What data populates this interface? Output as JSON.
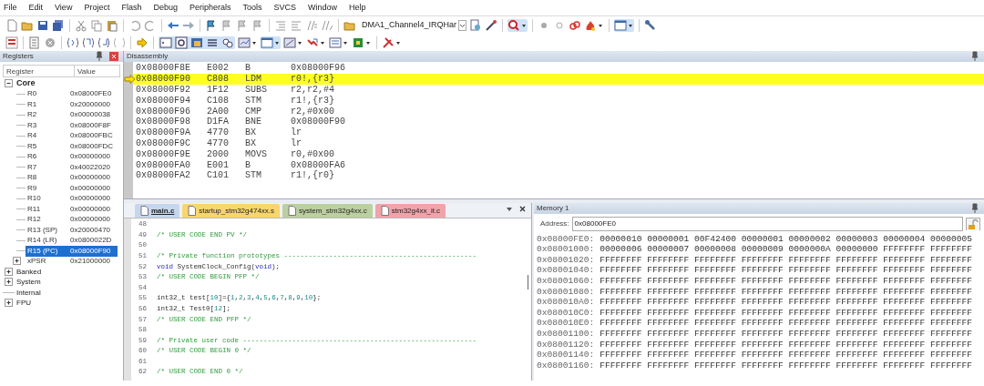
{
  "menu": [
    "File",
    "Edit",
    "View",
    "Project",
    "Flash",
    "Debug",
    "Peripherals",
    "Tools",
    "SVCS",
    "Window",
    "Help"
  ],
  "toolbar": {
    "function_combo": "DMA1_Channel4_IRQHar"
  },
  "registers": {
    "title": "Registers",
    "columns": [
      "Register",
      "Value"
    ],
    "tree": [
      {
        "name": "Core",
        "expanded": true,
        "children": [
          {
            "name": "R0",
            "value": "0x08000FE0",
            "selected": false
          },
          {
            "name": "R1",
            "value": "0x20000000",
            "selected": false
          },
          {
            "name": "R2",
            "value": "0x00000038",
            "selected": false
          },
          {
            "name": "R3",
            "value": "0x08000F8F",
            "selected": false
          },
          {
            "name": "R4",
            "value": "0x08000FBC",
            "selected": false
          },
          {
            "name": "R5",
            "value": "0x08000FDC",
            "selected": false
          },
          {
            "name": "R6",
            "value": "0x00000000",
            "selected": false
          },
          {
            "name": "R7",
            "value": "0x40022020",
            "selected": false
          },
          {
            "name": "R8",
            "value": "0x00000000",
            "selected": false
          },
          {
            "name": "R9",
            "value": "0x00000000",
            "selected": false
          },
          {
            "name": "R10",
            "value": "0x00000000",
            "selected": false
          },
          {
            "name": "R11",
            "value": "0x00000000",
            "selected": false
          },
          {
            "name": "R12",
            "value": "0x00000000",
            "selected": false
          },
          {
            "name": "R13 (SP)",
            "value": "0x20000470",
            "selected": false
          },
          {
            "name": "R14 (LR)",
            "value": "0x0800022D",
            "selected": false
          },
          {
            "name": "R15 (PC)",
            "value": "0x08000F90",
            "selected": true
          },
          {
            "name": "xPSR",
            "value": "0x21000000",
            "selected": false,
            "expanded": false
          }
        ]
      },
      {
        "name": "Banked",
        "expanded": false
      },
      {
        "name": "System",
        "expanded": false
      },
      {
        "name": "Internal"
      },
      {
        "name": "FPU",
        "expanded": false
      }
    ]
  },
  "disassembly": {
    "title": "Disassembly",
    "rows": [
      {
        "address": "0x08000F8E",
        "opcode": "E002",
        "mnemonic": "B",
        "operands": "0x08000F96",
        "current": false
      },
      {
        "address": "0x08000F90",
        "opcode": "C808",
        "mnemonic": "LDM",
        "operands": "r0!,{r3}",
        "current": true
      },
      {
        "address": "0x08000F92",
        "opcode": "1F12",
        "mnemonic": "SUBS",
        "operands": "r2,r2,#4",
        "current": false
      },
      {
        "address": "0x08000F94",
        "opcode": "C108",
        "mnemonic": "STM",
        "operands": "r1!,{r3}",
        "current": false
      },
      {
        "address": "0x08000F96",
        "opcode": "2A00",
        "mnemonic": "CMP",
        "operands": "r2,#0x00",
        "current": false
      },
      {
        "address": "0x08000F98",
        "opcode": "D1FA",
        "mnemonic": "BNE",
        "operands": "0x08000F90",
        "current": false
      },
      {
        "address": "0x08000F9A",
        "opcode": "4770",
        "mnemonic": "BX",
        "operands": "lr",
        "current": false
      },
      {
        "address": "0x08000F9C",
        "opcode": "4770",
        "mnemonic": "BX",
        "operands": "lr",
        "current": false
      },
      {
        "address": "0x08000F9E",
        "opcode": "2000",
        "mnemonic": "MOVS",
        "operands": "r0,#0x00",
        "current": false
      },
      {
        "address": "0x08000FA0",
        "opcode": "E001",
        "mnemonic": "B",
        "operands": "0x08000FA6",
        "current": false
      },
      {
        "address": "0x08000FA2",
        "opcode": "C101",
        "mnemonic": "STM",
        "operands": "r1!,{r0}",
        "current": false
      }
    ]
  },
  "editor": {
    "tabs": [
      {
        "label": "main.c",
        "selected": true,
        "color": "#c6d6ec"
      },
      {
        "label": "startup_stm32g474xx.s",
        "selected": false,
        "color": "#f8d66c"
      },
      {
        "label": "system_stm32g4xx.c",
        "selected": false,
        "color": "#bccf9f"
      },
      {
        "label": "stm32g4xx_it.c",
        "selected": false,
        "color": "#f1a3aa"
      }
    ],
    "lines": [
      {
        "number": "48"
      },
      {
        "number": "49",
        "tokens": [
          {
            "kind": "comment",
            "text": "/* USER CODE END PV */"
          }
        ]
      },
      {
        "number": "50"
      },
      {
        "number": "51",
        "tokens": [
          {
            "kind": "comment",
            "text": "/* Private function prototypes -----------------------------------------------"
          }
        ]
      },
      {
        "number": "52",
        "tokens": [
          {
            "kind": "keyword",
            "text": "void"
          },
          {
            "kind": "plain",
            "text": " SystemClock_Config("
          },
          {
            "kind": "keyword",
            "text": "void"
          },
          {
            "kind": "plain",
            "text": ");"
          }
        ]
      },
      {
        "number": "53",
        "tokens": [
          {
            "kind": "comment",
            "text": "/* USER CODE BEGIN PFP */"
          }
        ]
      },
      {
        "number": "54"
      },
      {
        "number": "55",
        "tokens": [
          {
            "kind": "plain",
            "text": "int32_t test["
          },
          {
            "kind": "number",
            "text": "10"
          },
          {
            "kind": "plain",
            "text": "]={"
          },
          {
            "kind": "number",
            "text": "1"
          },
          {
            "kind": "plain",
            "text": ","
          },
          {
            "kind": "number",
            "text": "2"
          },
          {
            "kind": "plain",
            "text": ","
          },
          {
            "kind": "number",
            "text": "3"
          },
          {
            "kind": "plain",
            "text": ","
          },
          {
            "kind": "number",
            "text": "4"
          },
          {
            "kind": "plain",
            "text": ","
          },
          {
            "kind": "number",
            "text": "5"
          },
          {
            "kind": "plain",
            "text": ","
          },
          {
            "kind": "number",
            "text": "6"
          },
          {
            "kind": "plain",
            "text": ","
          },
          {
            "kind": "number",
            "text": "7"
          },
          {
            "kind": "plain",
            "text": ","
          },
          {
            "kind": "number",
            "text": "8"
          },
          {
            "kind": "plain",
            "text": ","
          },
          {
            "kind": "number",
            "text": "9"
          },
          {
            "kind": "plain",
            "text": ","
          },
          {
            "kind": "number",
            "text": "10"
          },
          {
            "kind": "plain",
            "text": "};"
          }
        ]
      },
      {
        "number": "56",
        "tokens": [
          {
            "kind": "plain",
            "text": "int32_t Test0["
          },
          {
            "kind": "number",
            "text": "12"
          },
          {
            "kind": "plain",
            "text": "];"
          }
        ]
      },
      {
        "number": "57",
        "tokens": [
          {
            "kind": "comment",
            "text": "/* USER CODE END PFP */"
          }
        ]
      },
      {
        "number": "58"
      },
      {
        "number": "59",
        "tokens": [
          {
            "kind": "comment",
            "text": "/* Private user code ---------------------------------------------------------"
          }
        ]
      },
      {
        "number": "60",
        "tokens": [
          {
            "kind": "comment",
            "text": "/* USER CODE BEGIN 0 */"
          }
        ]
      },
      {
        "number": "61"
      },
      {
        "number": "62",
        "tokens": [
          {
            "kind": "comment",
            "text": "/* USER CODE END 0 */"
          }
        ]
      }
    ]
  },
  "memory": {
    "title": "Memory 1",
    "address_label": "Address:",
    "address": "0x08000FE0",
    "rows": [
      {
        "address": "0x08000FE0:",
        "values": "00000010 00000001 00F42400 00000001 00000002 00000003 00000004 00000005"
      },
      {
        "address": "0x08001000:",
        "values": "00000006 00000007 00000008 00000009 0000000A 00000000 FFFFFFFF FFFFFFFF"
      },
      {
        "address": "0x08001020:",
        "values": "FFFFFFFF FFFFFFFF FFFFFFFF FFFFFFFF FFFFFFFF FFFFFFFF FFFFFFFF FFFFFFFF"
      },
      {
        "address": "0x08001040:",
        "values": "FFFFFFFF FFFFFFFF FFFFFFFF FFFFFFFF FFFFFFFF FFFFFFFF FFFFFFFF FFFFFFFF"
      },
      {
        "address": "0x08001060:",
        "values": "FFFFFFFF FFFFFFFF FFFFFFFF FFFFFFFF FFFFFFFF FFFFFFFF FFFFFFFF FFFFFFFF"
      },
      {
        "address": "0x08001080:",
        "values": "FFFFFFFF FFFFFFFF FFFFFFFF FFFFFFFF FFFFFFFF FFFFFFFF FFFFFFFF FFFFFFFF"
      },
      {
        "address": "0x080010A0:",
        "values": "FFFFFFFF FFFFFFFF FFFFFFFF FFFFFFFF FFFFFFFF FFFFFFFF FFFFFFFF FFFFFFFF"
      },
      {
        "address": "0x080010C0:",
        "values": "FFFFFFFF FFFFFFFF FFFFFFFF FFFFFFFF FFFFFFFF FFFFFFFF FFFFFFFF FFFFFFFF"
      },
      {
        "address": "0x080010E0:",
        "values": "FFFFFFFF FFFFFFFF FFFFFFFF FFFFFFFF FFFFFFFF FFFFFFFF FFFFFFFF FFFFFFFF"
      },
      {
        "address": "0x08001100:",
        "values": "FFFFFFFF FFFFFFFF FFFFFFFF FFFFFFFF FFFFFFFF FFFFFFFF FFFFFFFF FFFFFFFF"
      },
      {
        "address": "0x08001120:",
        "values": "FFFFFFFF FFFFFFFF FFFFFFFF FFFFFFFF FFFFFFFF FFFFFFFF FFFFFFFF FFFFFFFF"
      },
      {
        "address": "0x08001140:",
        "values": "FFFFFFFF FFFFFFFF FFFFFFFF FFFFFFFF FFFFFFFF FFFFFFFF FFFFFFFF FFFFFFFF"
      },
      {
        "address": "0x08001160:",
        "values": "FFFFFFFF FFFFFFFF FFFFFFFF FFFFFFFF FFFFFFFF FFFFFFFF FFFFFFFF FFFFFFFF"
      }
    ]
  }
}
